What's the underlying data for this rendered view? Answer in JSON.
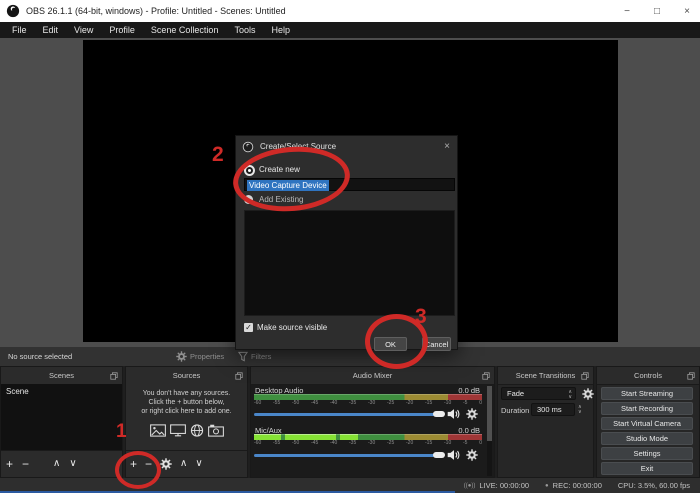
{
  "window": {
    "title": "OBS 26.1.1 (64-bit, windows) - Profile: Untitled - Scenes: Untitled"
  },
  "icons": {
    "minimize": "−",
    "maximize": "□",
    "close": "×",
    "plus": "+",
    "minus": "−",
    "up": "∧",
    "down": "∨",
    "spin_up": "∧",
    "spin_down": "∨",
    "check": "✓",
    "live_indicator": "((●))",
    "rec_dot": "●",
    "dialog_close": "×"
  },
  "menu": {
    "items": [
      "File",
      "Edit",
      "View",
      "Profile",
      "Scene Collection",
      "Tools",
      "Help"
    ]
  },
  "status_row": {
    "no_source": "No source selected",
    "properties": "Properties",
    "filters": "Filters"
  },
  "dialog": {
    "title": "Create/Select Source",
    "create_new_label": "Create new",
    "name_value": "Video Capture Device",
    "add_existing_label": "Add Existing",
    "make_visible_label": "Make source visible",
    "ok_label": "OK",
    "cancel_label": "Cancel"
  },
  "panels": {
    "scenes": {
      "title": "Scenes",
      "items": [
        "Scene"
      ]
    },
    "sources": {
      "title": "Sources",
      "empty_lines": [
        "You don't have any sources.",
        "Click the + button below,",
        "or right click here to add one."
      ]
    },
    "mixer": {
      "title": "Audio Mixer",
      "channels": [
        {
          "name": "Desktop Audio",
          "level": "0.0 dB"
        },
        {
          "name": "Mic/Aux",
          "level": "0.0 dB"
        }
      ],
      "ticks": [
        "-60",
        "-55",
        "-50",
        "-45",
        "-40",
        "-35",
        "-30",
        "-25",
        "-20",
        "-15",
        "-10",
        "-5",
        "0"
      ]
    },
    "transitions": {
      "title": "Scene Transitions",
      "transition_value": "Fade",
      "duration_label": "Duration",
      "duration_value": "300 ms"
    },
    "controls": {
      "title": "Controls",
      "buttons": [
        "Start Streaming",
        "Start Recording",
        "Start Virtual Camera",
        "Studio Mode",
        "Settings",
        "Exit"
      ]
    }
  },
  "statusbar": {
    "live": "LIVE: 00:00:00",
    "rec": "REC: 00:00:00",
    "cpu": "CPU: 3.5%, 60.00 fps"
  },
  "annotations": {
    "step1": "1",
    "step2": "2",
    "step3": "3"
  },
  "colors": {
    "annotation_red": "#cf2a27",
    "selection_blue": "#2f74c0",
    "meter_green": "#3f8f3f",
    "meter_yellow": "#9c8b33",
    "meter_red": "#a03636",
    "slider_blue": "#4a86c9"
  }
}
